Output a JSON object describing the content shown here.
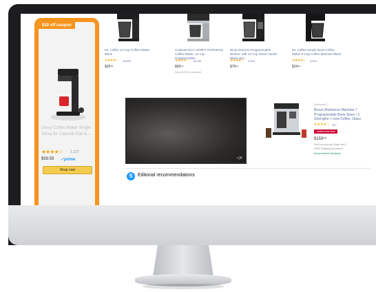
{
  "ad": {
    "badge": "$10 off coupon",
    "title": "Darcy Coffee Maker Single Serve for Capsule Pod &...",
    "stars": "★★★★☆",
    "rating_count": "1,137",
    "price": "$59.59",
    "prime": "✓prime",
    "shop_label": "Shop now"
  },
  "products": [
    {
      "title": "Mr. Coffee 12-Cup Coffee Maker, Black",
      "stars": "★★★★☆",
      "count": "18,840",
      "price": "$20⁸³",
      "sub": ""
    },
    {
      "title": "Cuisinart DCC-3200P1 Perfectemp Coffee Maker, 14 Cup Programmable...",
      "stars": "★★★★☆",
      "count": "18,439",
      "price": "$99⁹⁵",
      "sub": "Save $15.00 w/ discount"
    },
    {
      "title": "Ninja DCE101 Programmable Brewer, with 12-Cup Glass Carafe, Black and...",
      "stars": "★★★★☆",
      "count": "3,003",
      "price": "$79⁹⁹",
      "sub": ""
    },
    {
      "title": "Mr. Coffee Simple Brew Coffee Maker 5-Cup Coffee Machine Black",
      "stars": "★★★★☆",
      "count": "6,419",
      "price": "$24⁹⁹",
      "sub": ""
    }
  ],
  "right_product": {
    "sponsored": "Sponsored ⓘ",
    "title": "Bosch Multiserve Machine 7 Programmable Brew Sizes / 2 Strengths + Iced Coffee, Glass",
    "stars": "★★★★☆",
    "count": "927",
    "deal": "Limited time deal",
    "price": "$159⁹⁵",
    "ship": "Get it as soon as Friday, Nov 7",
    "ship2": "FREE Shipping by Amazon",
    "stock": "Arrives before Christmas"
  },
  "video": {
    "icon": "◁×"
  },
  "editorial_label": "Editorial recommendations",
  "colors": {
    "accent": "#f7941d",
    "stars": "#f0a30a",
    "link": "#5a6fa0",
    "prime": "#1a98ff"
  }
}
